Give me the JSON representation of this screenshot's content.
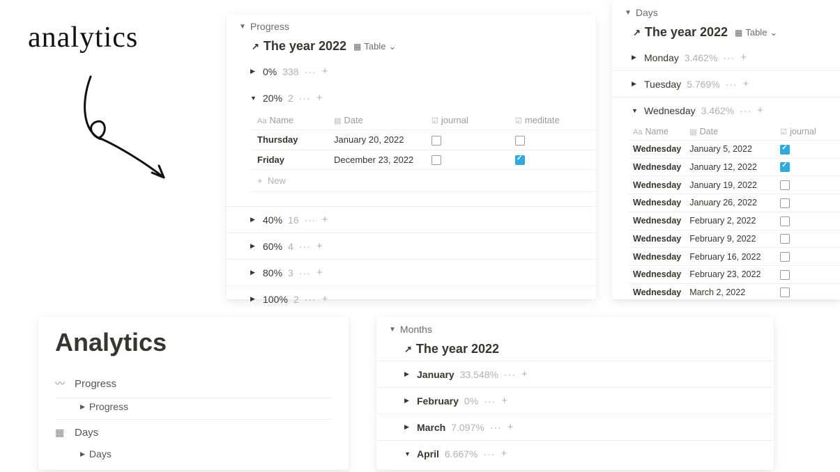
{
  "handwriting": "analytics",
  "progress": {
    "section": "Progress",
    "title": "The year 2022",
    "view": "Table",
    "groups": [
      {
        "label": "0%",
        "count": "338",
        "expanded": false
      },
      {
        "label": "20%",
        "count": "2",
        "expanded": true
      },
      {
        "label": "40%",
        "count": "16",
        "expanded": false
      },
      {
        "label": "60%",
        "count": "4",
        "expanded": false
      },
      {
        "label": "80%",
        "count": "3",
        "expanded": false
      },
      {
        "label": "100%",
        "count": "2",
        "expanded": false
      }
    ],
    "columns": {
      "name": "Name",
      "date": "Date",
      "journal": "journal",
      "meditate": "meditate"
    },
    "rows": [
      {
        "name": "Thursday",
        "date": "January 20, 2022",
        "journal": false,
        "meditate": false
      },
      {
        "name": "Friday",
        "date": "December 23, 2022",
        "journal": false,
        "meditate": true
      }
    ],
    "new_label": "New"
  },
  "days": {
    "section": "Days",
    "title": "The year 2022",
    "view": "Table",
    "groups": [
      {
        "label": "Monday",
        "count": "3.462%",
        "expanded": false
      },
      {
        "label": "Tuesday",
        "count": "5.769%",
        "expanded": false
      },
      {
        "label": "Wednesday",
        "count": "3.462%",
        "expanded": true
      }
    ],
    "columns": {
      "name": "Name",
      "date": "Date",
      "journal": "journal"
    },
    "rows": [
      {
        "name": "Wednesday",
        "date": "January 5, 2022",
        "journal": true
      },
      {
        "name": "Wednesday",
        "date": "January 12, 2022",
        "journal": true
      },
      {
        "name": "Wednesday",
        "date": "January 19, 2022",
        "journal": false
      },
      {
        "name": "Wednesday",
        "date": "January 26, 2022",
        "journal": false
      },
      {
        "name": "Wednesday",
        "date": "February 2, 2022",
        "journal": false
      },
      {
        "name": "Wednesday",
        "date": "February 9, 2022",
        "journal": false
      },
      {
        "name": "Wednesday",
        "date": "February 16, 2022",
        "journal": false
      },
      {
        "name": "Wednesday",
        "date": "February 23, 2022",
        "journal": false
      },
      {
        "name": "Wednesday",
        "date": "March 2, 2022",
        "journal": false
      }
    ]
  },
  "months": {
    "section": "Months",
    "title": "The year 2022",
    "groups": [
      {
        "label": "January",
        "count": "33.548%",
        "expanded": false
      },
      {
        "label": "February",
        "count": "0%",
        "expanded": false
      },
      {
        "label": "March",
        "count": "7.097%",
        "expanded": false
      },
      {
        "label": "April",
        "count": "6.667%",
        "expanded": true
      }
    ]
  },
  "analytics": {
    "title": "Analytics",
    "items": [
      {
        "icon": "trend",
        "label": "Progress",
        "sub": "Progress"
      },
      {
        "icon": "calendar",
        "label": "Days",
        "sub": "Days"
      }
    ]
  }
}
